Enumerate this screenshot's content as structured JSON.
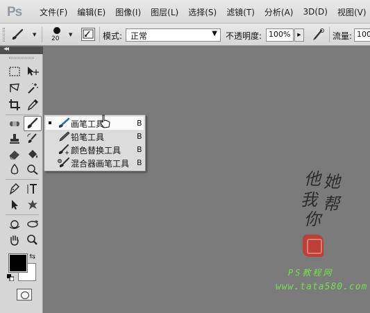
{
  "app": {
    "logo": "Ps"
  },
  "menu": [
    "文件(F)",
    "编辑(E)",
    "图像(I)",
    "图层(L)",
    "选择(S)",
    "滤镜(T)",
    "分析(A)",
    "3D(D)",
    "视图(V)"
  ],
  "options": {
    "brush_size": "20",
    "mode_label": "模式:",
    "mode_value": "正常",
    "opacity_label": "不透明度:",
    "opacity_value": "100%",
    "flow_label": "流量:",
    "flow_value": "100"
  },
  "colors": {
    "foreground": "#000000",
    "background": "#ffffff",
    "canvas": "#7b7b7b",
    "brush_icon": "#2a6fb3"
  },
  "flyout": {
    "items": [
      {
        "label": "画笔工具",
        "key": "B",
        "icon": "brush-icon",
        "selected": true
      },
      {
        "label": "铅笔工具",
        "key": "B",
        "icon": "pencil-icon",
        "selected": false
      },
      {
        "label": "颜色替换工具",
        "key": "B",
        "icon": "color-replacement-icon",
        "selected": false
      },
      {
        "label": "混合器画笔工具",
        "key": "B",
        "icon": "mixer-brush-icon",
        "selected": false
      }
    ]
  },
  "watermark": {
    "calligraphy": [
      "他",
      "她",
      "我",
      "帮",
      "你"
    ],
    "site_name": "PS教程网",
    "site_url": "www.tata580.com"
  }
}
